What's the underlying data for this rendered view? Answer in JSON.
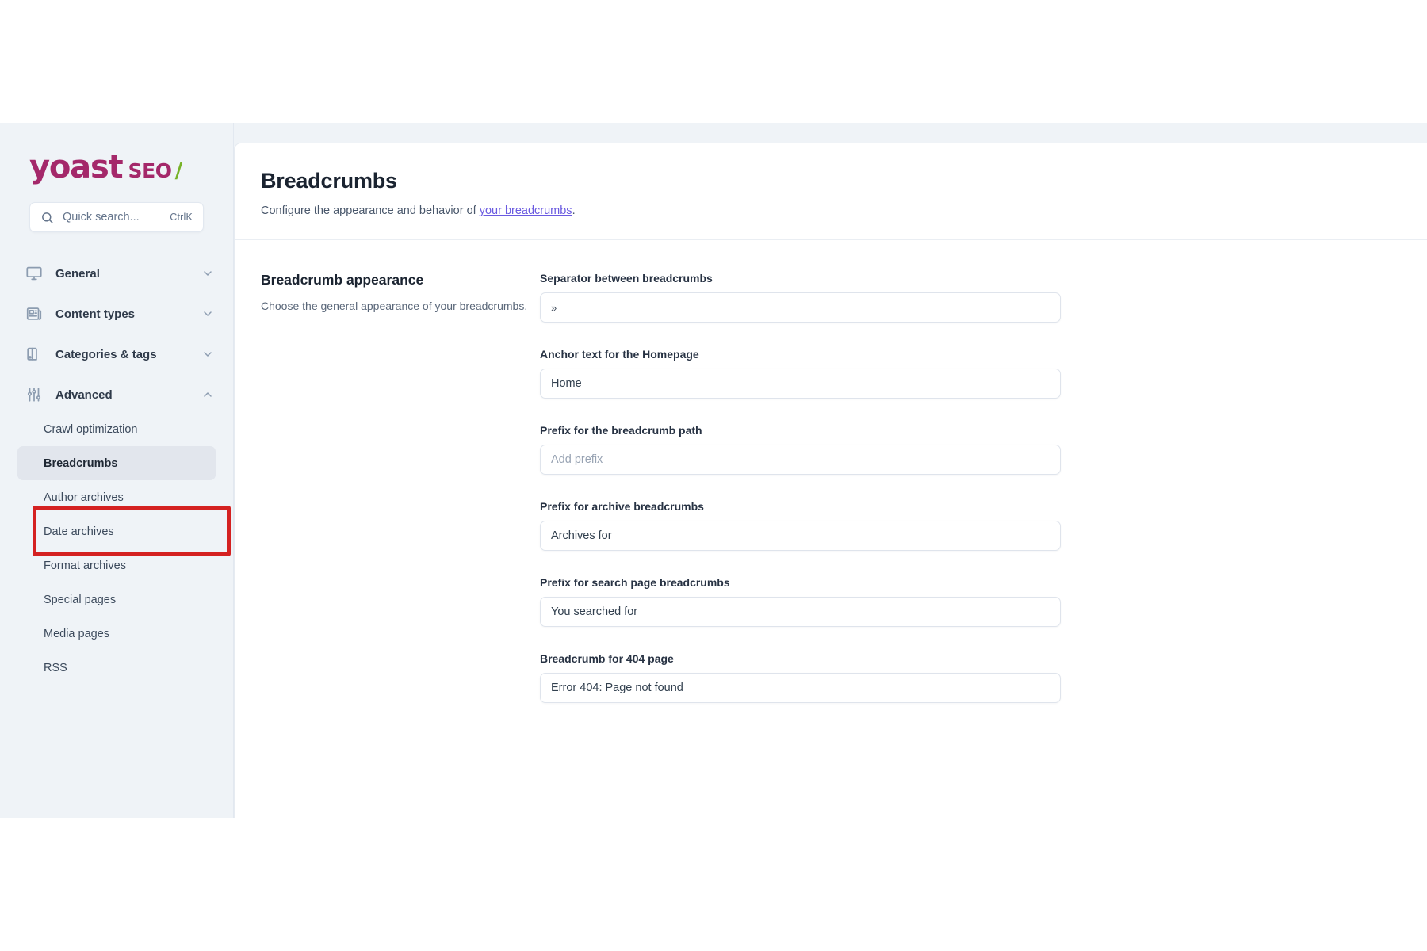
{
  "brand": {
    "name": "yoast",
    "product": "SEO",
    "slash": "/",
    "color_primary": "#a4286a",
    "color_accent": "#77b227"
  },
  "search": {
    "placeholder": "Quick search...",
    "shortcut": "CtrlK",
    "icon": "search-icon"
  },
  "sidebar": {
    "background": "#eff3f7",
    "groups": [
      {
        "label": "General",
        "icon": "monitor-icon",
        "expanded": false,
        "chevron": "chevron-down-icon"
      },
      {
        "label": "Content types",
        "icon": "newspaper-icon",
        "expanded": false,
        "chevron": "chevron-down-icon"
      },
      {
        "label": "Categories & tags",
        "icon": "swatch-icon",
        "expanded": false,
        "chevron": "chevron-down-icon"
      },
      {
        "label": "Advanced",
        "icon": "sliders-icon",
        "expanded": true,
        "chevron": "chevron-up-icon"
      }
    ],
    "advanced_items": [
      {
        "label": "Crawl optimization",
        "active": false
      },
      {
        "label": "Breadcrumbs",
        "active": true
      },
      {
        "label": "Author archives",
        "active": false
      },
      {
        "label": "Date archives",
        "active": false
      },
      {
        "label": "Format archives",
        "active": false
      },
      {
        "label": "Special pages",
        "active": false
      },
      {
        "label": "Media pages",
        "active": false
      },
      {
        "label": "RSS",
        "active": false
      }
    ]
  },
  "highlight": {
    "target": "Breadcrumbs",
    "color": "#d42121"
  },
  "header": {
    "title": "Breadcrumbs",
    "subtitle_before": "Configure the appearance and behavior of ",
    "subtitle_link": "your breadcrumbs",
    "subtitle_after": ".",
    "link_color": "#6a5ae0"
  },
  "appearance": {
    "title": "Breadcrumb appearance",
    "description": "Choose the general appearance of your breadcrumbs."
  },
  "fields": [
    {
      "label": "Separator between breadcrumbs",
      "value": "»",
      "placeholder": "",
      "name": "separator-input"
    },
    {
      "label": "Anchor text for the Homepage",
      "value": "Home",
      "placeholder": "",
      "name": "homepage-anchor-input"
    },
    {
      "label": "Prefix for the breadcrumb path",
      "value": "",
      "placeholder": "Add prefix",
      "name": "breadcrumb-path-prefix-input"
    },
    {
      "label": "Prefix for archive breadcrumbs",
      "value": "Archives for",
      "placeholder": "",
      "name": "archive-prefix-input"
    },
    {
      "label": "Prefix for search page breadcrumbs",
      "value": "You searched for",
      "placeholder": "",
      "name": "search-page-prefix-input"
    },
    {
      "label": "Breadcrumb for 404 page",
      "value": "Error 404: Page not found",
      "placeholder": "",
      "name": "error-404-input"
    }
  ]
}
